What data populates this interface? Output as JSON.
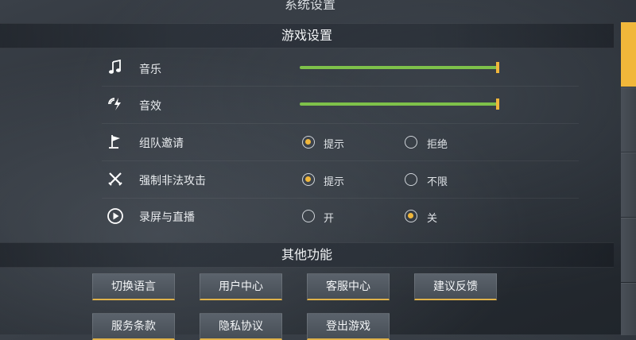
{
  "window_title": "系统设置",
  "sections": {
    "game_settings_title": "游戏设置",
    "other_title": "其他功能"
  },
  "settings": {
    "music": {
      "label": "音乐",
      "icon": "music-note-icon",
      "level": 1.0
    },
    "sfx": {
      "label": "音效",
      "icon": "sound-effect-icon",
      "level": 1.0
    },
    "team_invite": {
      "label": "组队邀请",
      "icon": "flag-icon",
      "options": [
        "提示",
        "拒绝"
      ],
      "selected": "提示"
    },
    "forced_attack": {
      "label": "强制非法攻击",
      "icon": "crossed-swords-icon",
      "options": [
        "提示",
        "不限"
      ],
      "selected": "提示"
    },
    "record_stream": {
      "label": "录屏与直播",
      "icon": "play-circle-icon",
      "options": [
        "开",
        "关"
      ],
      "selected": "关"
    }
  },
  "buttons": {
    "switch_language": "切换语言",
    "user_center": "用户中心",
    "customer_service": "客服中心",
    "feedback": "建议反馈",
    "terms": "服务条款",
    "privacy": "隐私协议",
    "logout": "登出游戏"
  },
  "colors": {
    "accent": "#f0b73b",
    "slider_fill": "#7ec14a",
    "active_tab": "#f1b73a"
  }
}
